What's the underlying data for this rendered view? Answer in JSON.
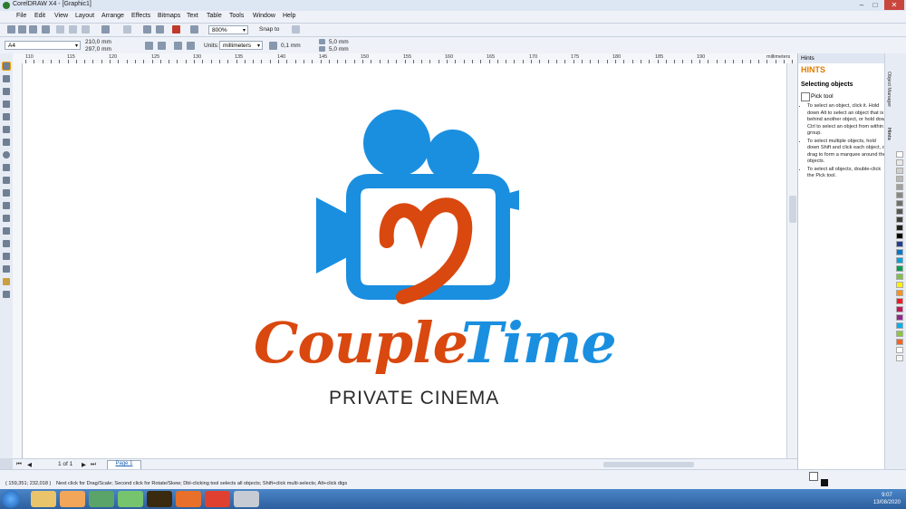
{
  "window": {
    "title": "CorelDRAW X4 - [Graphic1]",
    "min": "–",
    "max": "□",
    "close": "✕"
  },
  "menu": [
    "File",
    "Edit",
    "View",
    "Layout",
    "Arrange",
    "Effects",
    "Bitmaps",
    "Text",
    "Table",
    "Tools",
    "Window",
    "Help"
  ],
  "toolbar": {
    "zoom": "800%",
    "snap": "Snap to"
  },
  "propbar": {
    "paper": "A4",
    "width": "210,0 mm",
    "height": "297,0 mm",
    "units_label": "Units:",
    "units": "millimeters",
    "nudge": "0,1 mm",
    "dup_x": "5,0 mm",
    "dup_y": "5,0 mm"
  },
  "ruler": {
    "ticks": [
      "110",
      "115",
      "120",
      "125",
      "130",
      "135",
      "140",
      "145",
      "150",
      "155",
      "160",
      "165",
      "170",
      "175",
      "180",
      "185",
      "190"
    ],
    "unit": "millimeters"
  },
  "logo": {
    "word1": "Couple",
    "word2": "Time",
    "tagline": "PRIVATE CINEMA",
    "colors": {
      "blue": "#1a8fe0",
      "orange": "#d9480f",
      "dark": "#2b2b2b"
    }
  },
  "docker": {
    "header": "Hints",
    "title": "HINTS",
    "subtitle": "Selecting objects",
    "tool": "Pick tool",
    "bullets": [
      "To select an object, click it. Hold down Alt to select an object that is behind another object, or hold down Ctrl to select an object from within a group.",
      "To select multiple objects, hold down Shift and click each object, or drag to form a marquee around the objects.",
      "To select all objects, double-click the Pick tool."
    ],
    "tabs": [
      "Object Manager",
      "Hints"
    ]
  },
  "pages": {
    "count": "1 of 1",
    "tab": "Page 1"
  },
  "status": {
    "coords": "( 159,351; 232,018 )",
    "message": "Next click for Drag/Scale; Second click for Rotate/Skew; Dbl-clicking tool selects all objects; Shift+click multi-selects; Alt+click digs"
  },
  "clock": {
    "time": "9:07",
    "date": "13/08/2020"
  },
  "palette": [
    "#ffffff",
    "#e8e8e8",
    "#d0d0d0",
    "#b8b8b8",
    "#a0a0a0",
    "#888888",
    "#707070",
    "#585858",
    "#404040",
    "#202020",
    "#000000",
    "#1f3f8f",
    "#0077c8",
    "#00a0e0",
    "#009e4f",
    "#7dc242",
    "#fff200",
    "#f7941d",
    "#ed1c24",
    "#c2185b",
    "#92278f",
    "#00aeef",
    "#8dc63f",
    "#f26522",
    "#ffffff",
    "#f5f5f5"
  ]
}
